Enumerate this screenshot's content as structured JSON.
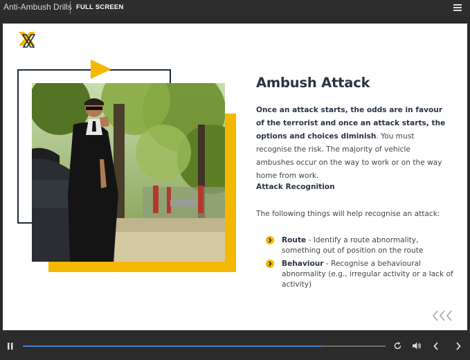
{
  "topbar": {
    "title": "Anti-Ambush Drills",
    "fullscreen_label": "FULL SCREEN"
  },
  "slide": {
    "heading": "Ambush Attack",
    "intro_bold": "Once an attack starts, the odds are in favour of the terrorist and once an attack starts, the options and choices diminish",
    "intro_rest": ". You must recognise the risk. The majority of vehicle ambushes occur on the way to work or on the way home from work.",
    "subheading": "Attack Recognition",
    "lead": "The following things will help recognise an attack:",
    "bullets": [
      {
        "term": "Route",
        "text": " - Identify a route abnormality, something out of position on the route"
      },
      {
        "term": "Behaviour",
        "text": " - Recognise a behavioural abnormality (e.g., irregular activity or a lack of activity)"
      }
    ]
  },
  "player": {
    "progress_fraction": 0.825
  },
  "colors": {
    "accent": "#f5b800",
    "navy": "#1f2a3a",
    "progress": "#3a86d8"
  }
}
